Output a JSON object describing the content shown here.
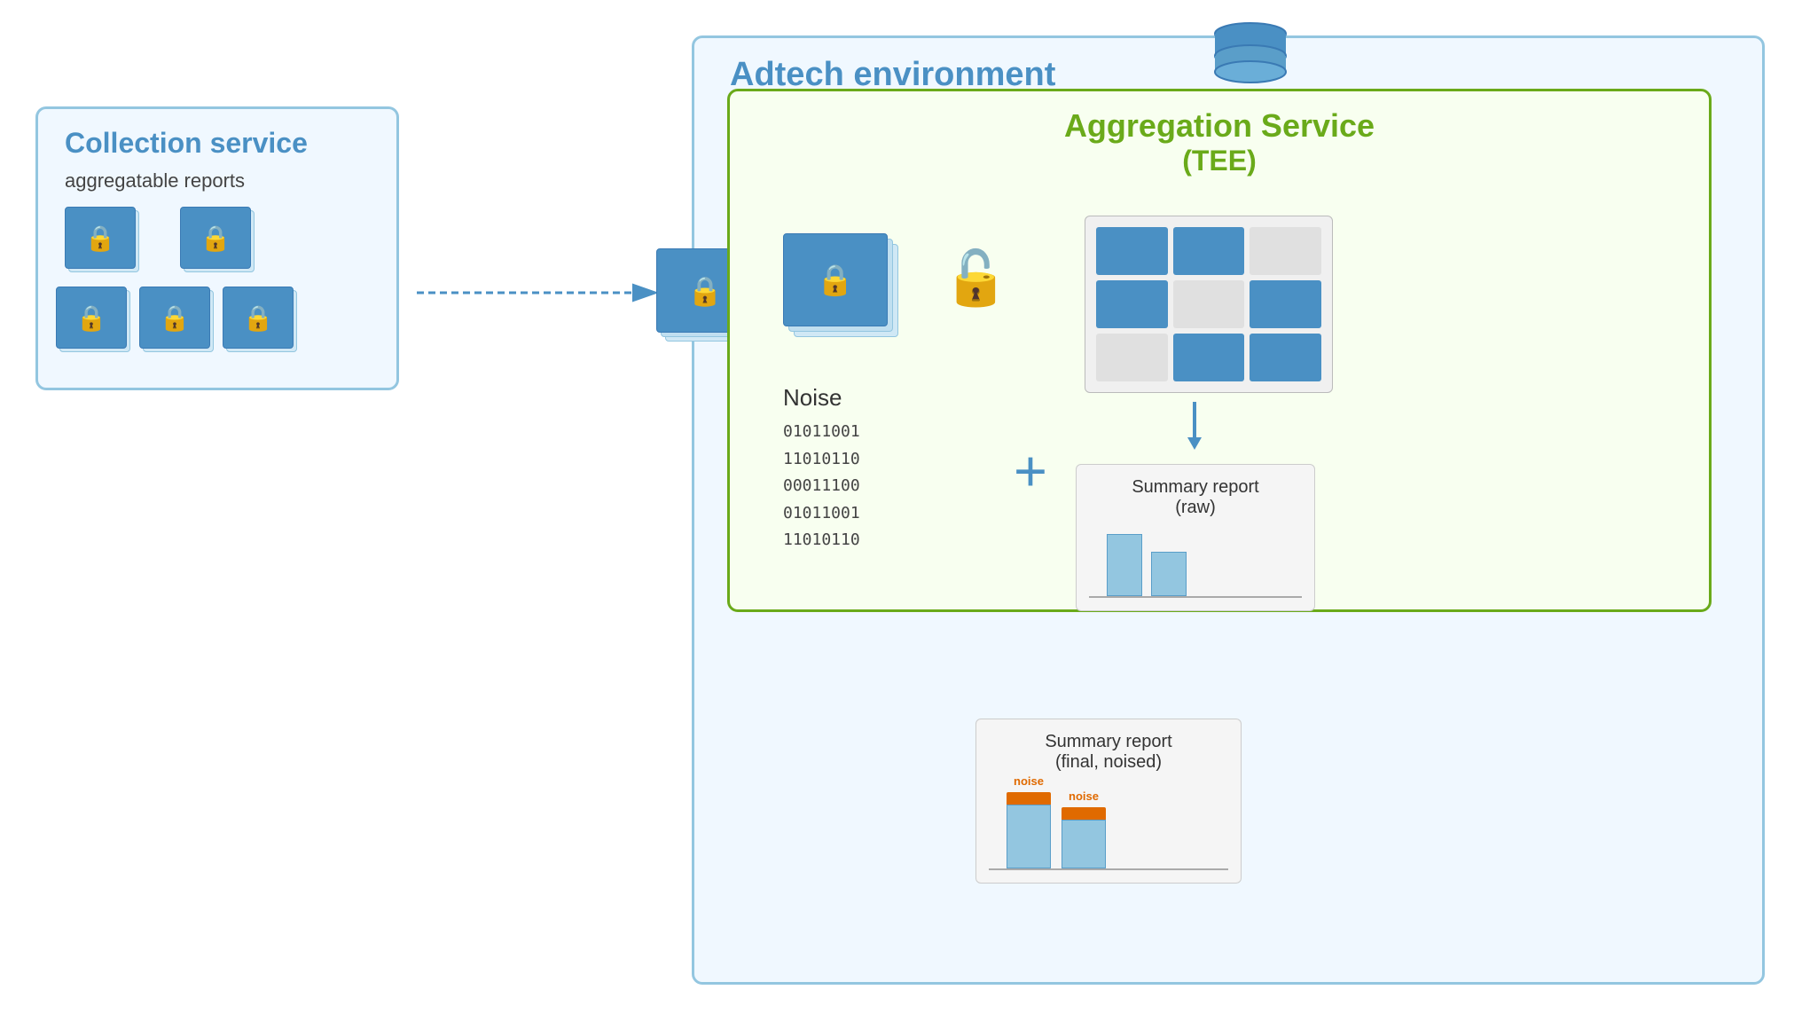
{
  "adtech": {
    "title": "Adtech environment"
  },
  "collection": {
    "title": "Collection service",
    "subtitle": "aggregatable reports"
  },
  "aggregation": {
    "title": "Aggregation Service",
    "subtitle": "(TEE)"
  },
  "noise": {
    "label": "Noise",
    "binary": "01011001\n11010110\n00011100\n01011001\n11010110"
  },
  "summary_raw": {
    "label1": "Summary report",
    "label2": "(raw)"
  },
  "summary_final": {
    "label1": "Summary report",
    "label2": "(final, noised)"
  },
  "noise_bar_label": "noise",
  "plus": "+"
}
